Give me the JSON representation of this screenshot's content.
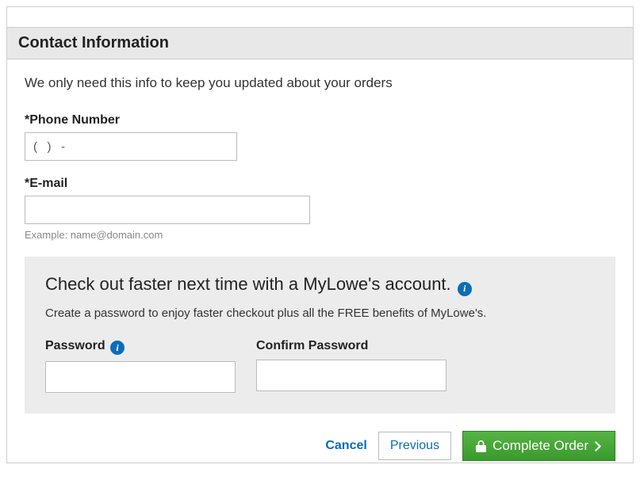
{
  "section": {
    "title": "Contact Information"
  },
  "intro": "We only need this info to keep you updated about your orders",
  "phone": {
    "label": "*Phone Number",
    "value": "(   )   -"
  },
  "email": {
    "label": "*E-mail",
    "value": "",
    "hint": "Example: name@domain.com"
  },
  "promo": {
    "title": "Check out faster next time with a MyLowe's account.",
    "subtitle": "Create a password to enjoy faster checkout plus all the FREE benefits of MyLowe's.",
    "password_label": "Password",
    "confirm_label": "Confirm Password"
  },
  "actions": {
    "cancel": "Cancel",
    "previous": "Previous",
    "complete": "Complete Order"
  },
  "icons": {
    "info": "i"
  }
}
